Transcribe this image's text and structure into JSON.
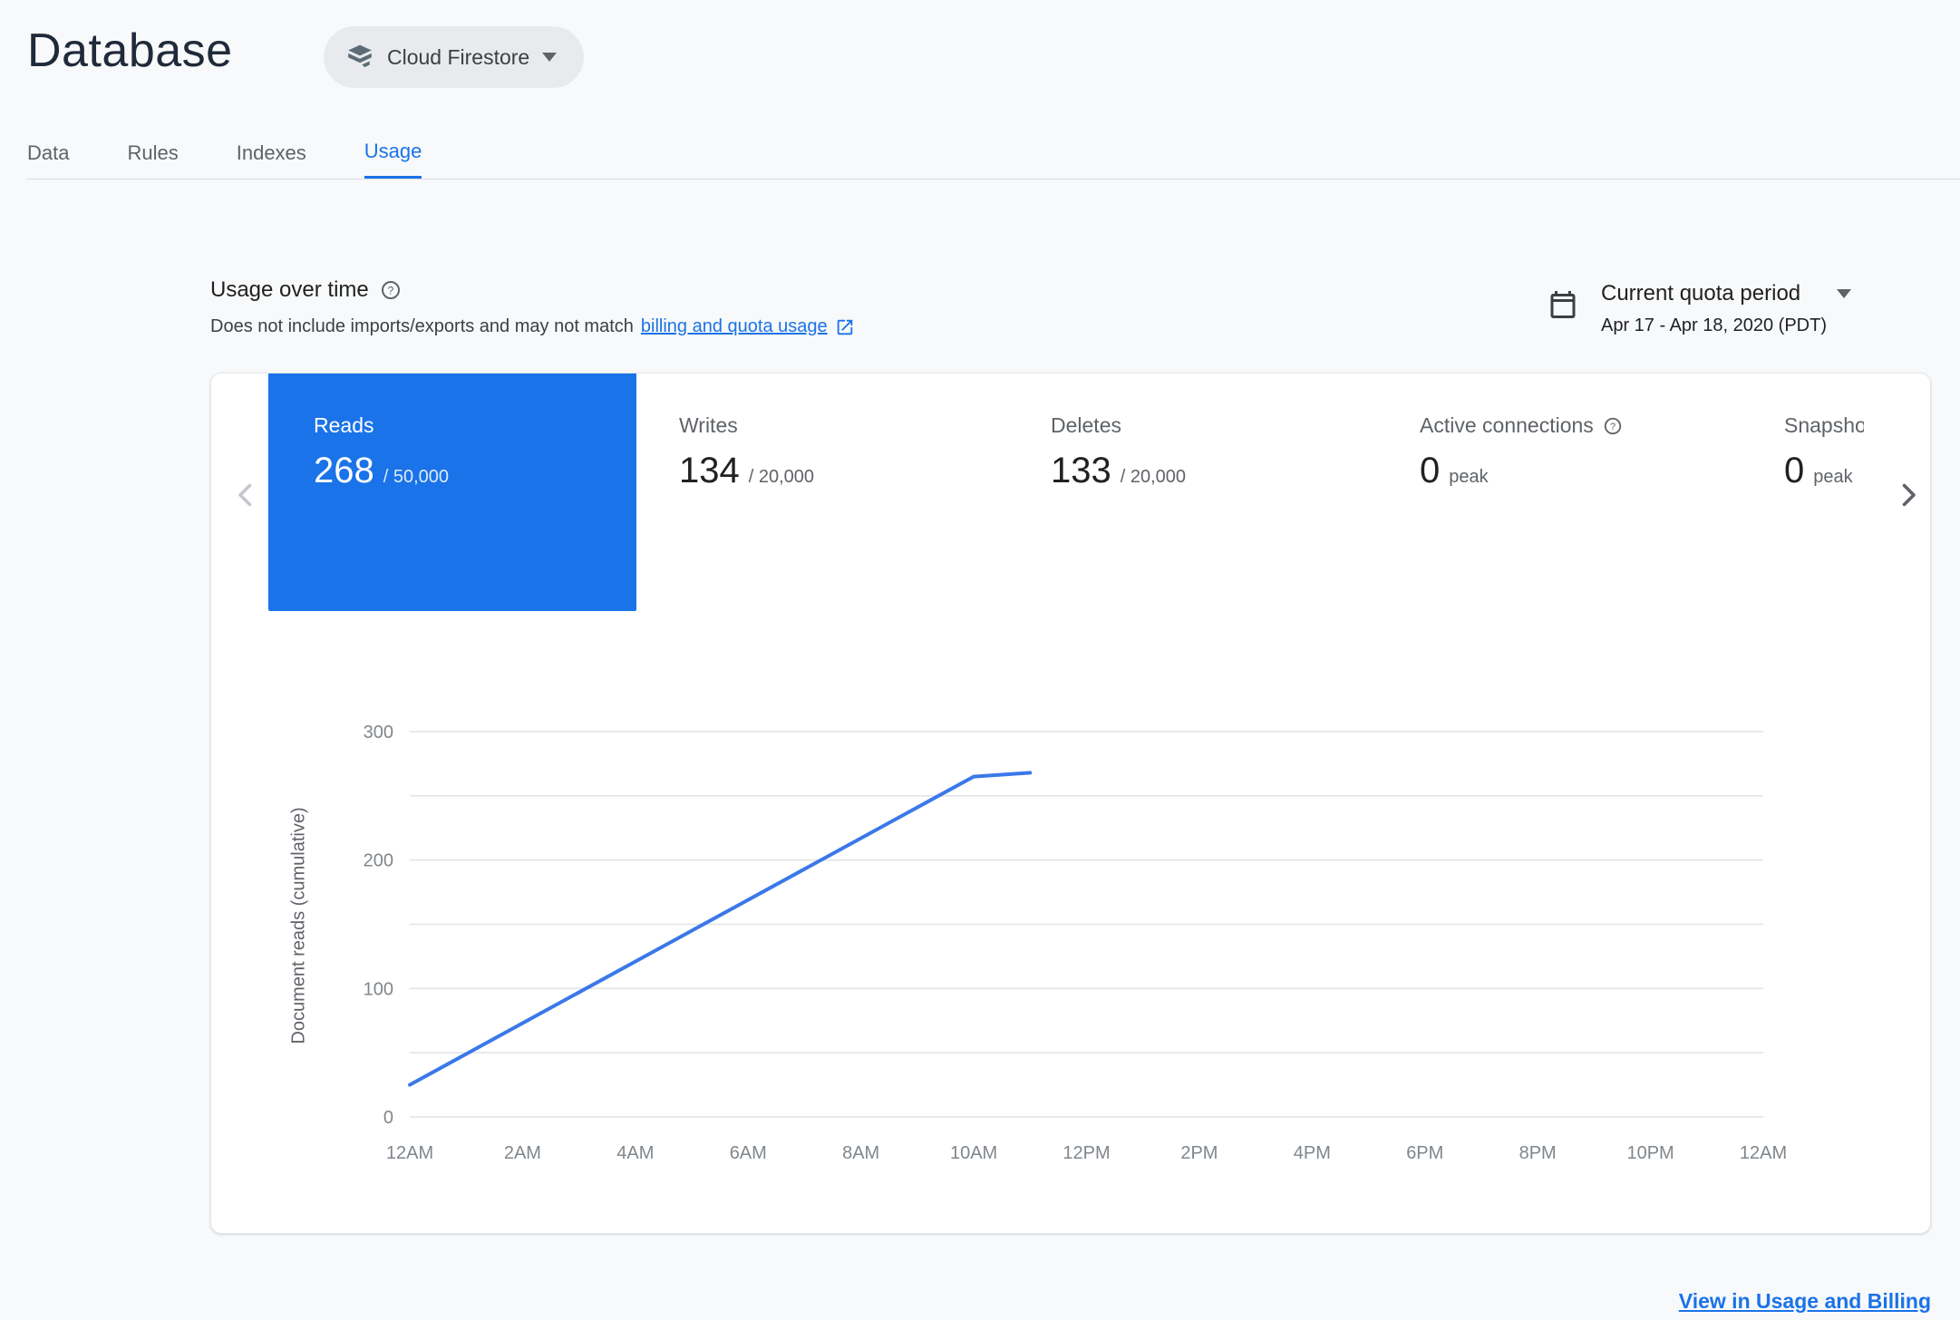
{
  "header": {
    "title": "Database",
    "database_selector": {
      "label": "Cloud Firestore"
    }
  },
  "tabs": [
    {
      "label": "Data"
    },
    {
      "label": "Rules"
    },
    {
      "label": "Indexes"
    },
    {
      "label": "Usage"
    }
  ],
  "active_tab": "Usage",
  "usage_header": {
    "title": "Usage over time",
    "description_prefix": "Does not include imports/exports and may not match",
    "description_link": "billing and quota usage",
    "quota_selector": {
      "label": "Current quota period",
      "period": "Apr 17 - Apr 18, 2020 (PDT)"
    }
  },
  "metrics": [
    {
      "label": "Reads",
      "value": "268",
      "quota": "/ 50,000",
      "selected": true
    },
    {
      "label": "Writes",
      "value": "134",
      "quota": "/ 20,000",
      "selected": false
    },
    {
      "label": "Deletes",
      "value": "133",
      "quota": "/ 20,000",
      "selected": false
    },
    {
      "label": "Active connections",
      "value": "0",
      "quota": "peak",
      "selected": false
    },
    {
      "label": "Snapshot listeners",
      "value": "0",
      "quota": "peak",
      "selected": false
    }
  ],
  "chart_data": {
    "type": "line",
    "title": "",
    "ylabel": "Document reads (cumulative)",
    "xlabel": "",
    "x_tick_labels": [
      "12AM",
      "2AM",
      "4AM",
      "6AM",
      "8AM",
      "10AM",
      "12PM",
      "2PM",
      "4PM",
      "6PM",
      "8PM",
      "10PM",
      "12AM"
    ],
    "x_domain_hours": [
      0,
      24
    ],
    "ylim": [
      0,
      300
    ],
    "y_tick_labels": [
      0,
      100,
      200,
      300
    ],
    "gridline_step": 50,
    "grid": true,
    "legend": false,
    "series": [
      {
        "name": "Document reads (cumulative)",
        "points_hours_value": [
          [
            0,
            25
          ],
          [
            10,
            265
          ],
          [
            11,
            268
          ]
        ],
        "color": "#3b78e8"
      }
    ]
  },
  "footer": {
    "link_label": "View in Usage and Billing"
  },
  "colors": {
    "accent": "#1a73e8",
    "selected_tile": "#1a73e8",
    "line": "#3b78e8",
    "gridline": "#e2e4e7",
    "tick_text": "#80868b"
  }
}
